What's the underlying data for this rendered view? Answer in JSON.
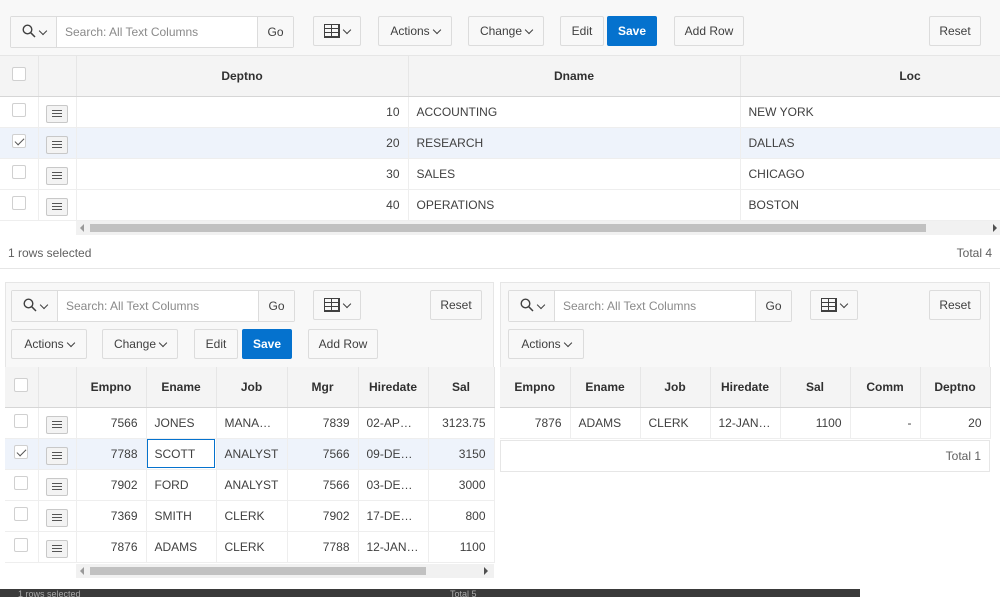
{
  "top": {
    "search_placeholder": "Search: All Text Columns",
    "go": "Go",
    "actions": "Actions",
    "change": "Change",
    "edit": "Edit",
    "save": "Save",
    "add_row": "Add Row",
    "reset": "Reset",
    "columns": [
      "Deptno",
      "Dname",
      "Loc"
    ],
    "rows": [
      {
        "deptno": "10",
        "dname": "ACCOUNTING",
        "loc": "NEW YORK",
        "selected": false
      },
      {
        "deptno": "20",
        "dname": "RESEARCH",
        "loc": "DALLAS",
        "selected": true
      },
      {
        "deptno": "30",
        "dname": "SALES",
        "loc": "CHICAGO",
        "selected": false
      },
      {
        "deptno": "40",
        "dname": "OPERATIONS",
        "loc": "BOSTON",
        "selected": false
      }
    ],
    "selected_text": "1 rows selected",
    "total": "Total 4"
  },
  "left": {
    "search_placeholder": "Search: All Text Columns",
    "go": "Go",
    "reset": "Reset",
    "actions": "Actions",
    "change": "Change",
    "edit": "Edit",
    "save": "Save",
    "add_row": "Add Row",
    "columns": [
      "Empno",
      "Ename",
      "Job",
      "Mgr",
      "Hiredate",
      "Sal"
    ],
    "rows": [
      {
        "empno": "7566",
        "ename": "JONES",
        "job": "MANAGE...",
        "mgr": "7839",
        "hiredate": "02-APR-8...",
        "sal": "3123.75",
        "selected": false
      },
      {
        "empno": "7788",
        "ename": "SCOTT",
        "job": "ANALYST",
        "mgr": "7566",
        "hiredate": "09-DEC-...",
        "sal": "3150",
        "selected": true
      },
      {
        "empno": "7902",
        "ename": "FORD",
        "job": "ANALYST",
        "mgr": "7566",
        "hiredate": "03-DEC-...",
        "sal": "3000",
        "selected": false
      },
      {
        "empno": "7369",
        "ename": "SMITH",
        "job": "CLERK",
        "mgr": "7902",
        "hiredate": "17-DEC-...",
        "sal": "800",
        "selected": false
      },
      {
        "empno": "7876",
        "ename": "ADAMS",
        "job": "CLERK",
        "mgr": "7788",
        "hiredate": "12-JAN-8...",
        "sal": "1100",
        "selected": false
      }
    ],
    "footer_left": "1 rows selected",
    "footer_right": "Total 5"
  },
  "right": {
    "search_placeholder": "Search: All Text Columns",
    "go": "Go",
    "reset": "Reset",
    "actions": "Actions",
    "columns": [
      "Empno",
      "Ename",
      "Job",
      "Hiredate",
      "Sal",
      "Comm",
      "Deptno"
    ],
    "rows": [
      {
        "empno": "7876",
        "ename": "ADAMS",
        "job": "CLERK",
        "hiredate": "12-JAN-...",
        "sal": "1100",
        "comm": "-",
        "deptno": "20"
      }
    ],
    "total": "Total 1"
  },
  "colors": {
    "accent": "#0572ce",
    "selected_row": "#eef3fb",
    "header_bg": "#f4f4f4"
  }
}
